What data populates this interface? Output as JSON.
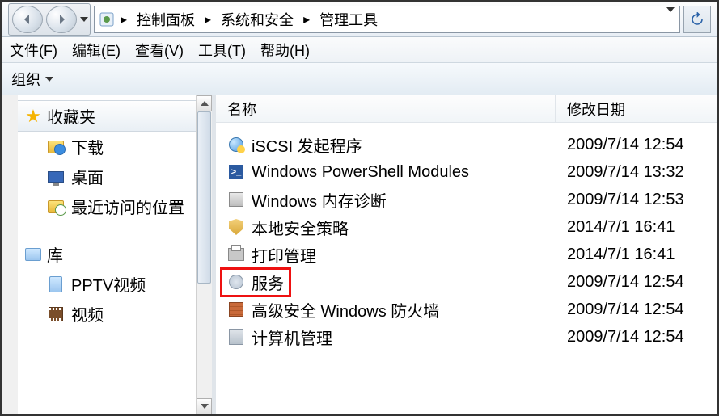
{
  "breadcrumb": {
    "root": "控制面板",
    "mid": "系统和安全",
    "leaf": "管理工具"
  },
  "menubar": {
    "file": "文件(F)",
    "edit": "编辑(E)",
    "view": "查看(V)",
    "tools": "工具(T)",
    "help": "帮助(H)"
  },
  "toolbar": {
    "organize": "组织"
  },
  "nav": {
    "favorites": "收藏夹",
    "fav_items": {
      "downloads": "下载",
      "desktop": "桌面",
      "recent": "最近访问的位置"
    },
    "library": "库",
    "lib_items": {
      "pptv": "PPTV视频",
      "video": "视频"
    }
  },
  "columns": {
    "name": "名称",
    "date": "修改日期"
  },
  "files": [
    {
      "name": "iSCSI 发起程序",
      "date": "2009/7/14 12:54",
      "icon": "globe"
    },
    {
      "name": "Windows PowerShell Modules",
      "date": "2009/7/14 13:32",
      "icon": "ps"
    },
    {
      "name": "Windows 内存诊断",
      "date": "2009/7/14 12:53",
      "icon": "chip"
    },
    {
      "name": "本地安全策略",
      "date": "2014/7/1 16:41",
      "icon": "shield"
    },
    {
      "name": "打印管理",
      "date": "2014/7/1 16:41",
      "icon": "printer"
    },
    {
      "name": "服务",
      "date": "2009/7/14 12:54",
      "icon": "gear",
      "highlight": true
    },
    {
      "name": "高级安全 Windows 防火墙",
      "date": "2009/7/14 12:54",
      "icon": "firewall"
    },
    {
      "name": "计算机管理",
      "date": "2009/7/14 12:54",
      "icon": "server"
    }
  ]
}
